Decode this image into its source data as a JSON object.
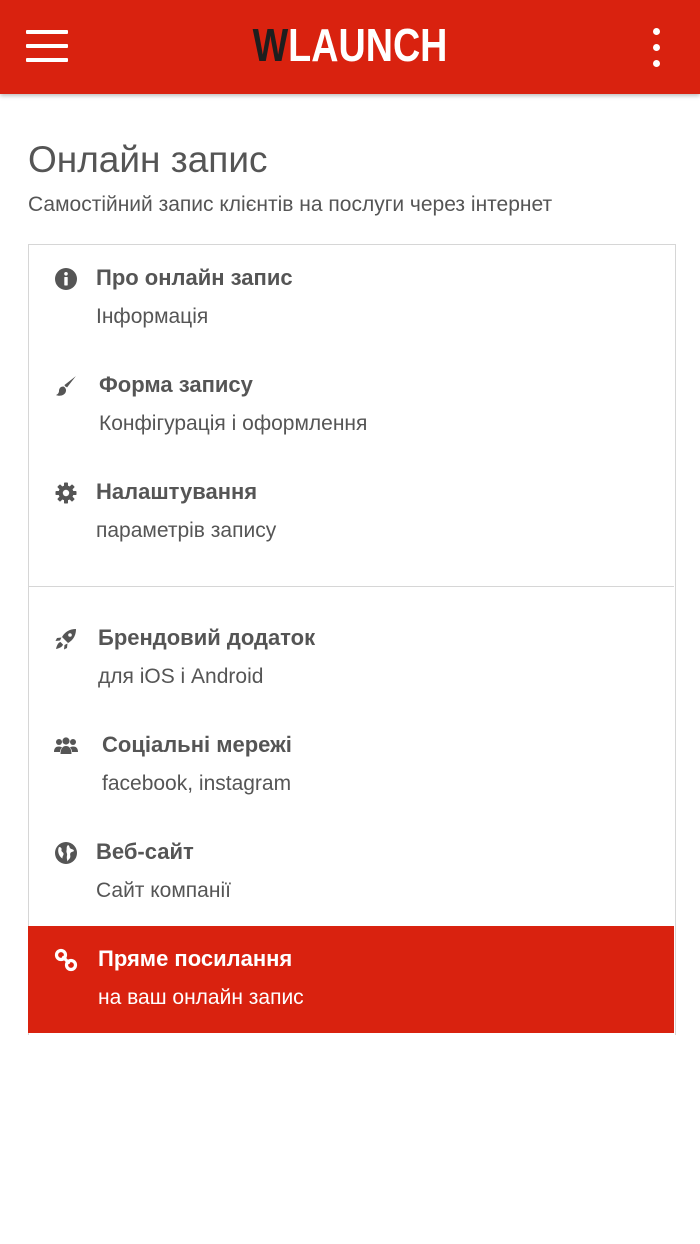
{
  "header": {
    "logo_w": "W",
    "logo_rest": "LAUNCH",
    "menu_icon": "hamburger-icon",
    "more_icon": "kebab-menu-icon"
  },
  "page": {
    "title": "Онлайн запис",
    "subtitle": "Самостійний запис клієнтів на послуги через інтернет"
  },
  "menu": {
    "items": [
      {
        "icon": "info-icon",
        "title": "Про онлайн запис",
        "subtitle": "Інформація"
      },
      {
        "icon": "brush-icon",
        "title": "Форма запису",
        "subtitle": "Конфігурація і оформлення"
      },
      {
        "icon": "gear-icon",
        "title": "Налаштування",
        "subtitle": "параметрів запису"
      },
      {
        "icon": "rocket-icon",
        "title": "Брендовий додаток",
        "subtitle": "для iOS і Android"
      },
      {
        "icon": "users-icon",
        "title": "Соціальні мережі",
        "subtitle": "facebook, instagram"
      },
      {
        "icon": "globe-icon",
        "title": "Веб-сайт",
        "subtitle": "Сайт компанії"
      },
      {
        "icon": "link-icon",
        "title": "Пряме посилання",
        "subtitle": "на ваш онлайн запис",
        "active": true
      }
    ]
  },
  "colors": {
    "brand": "#d9220f",
    "text": "#555555",
    "logo_dark": "#1e1e1e"
  }
}
